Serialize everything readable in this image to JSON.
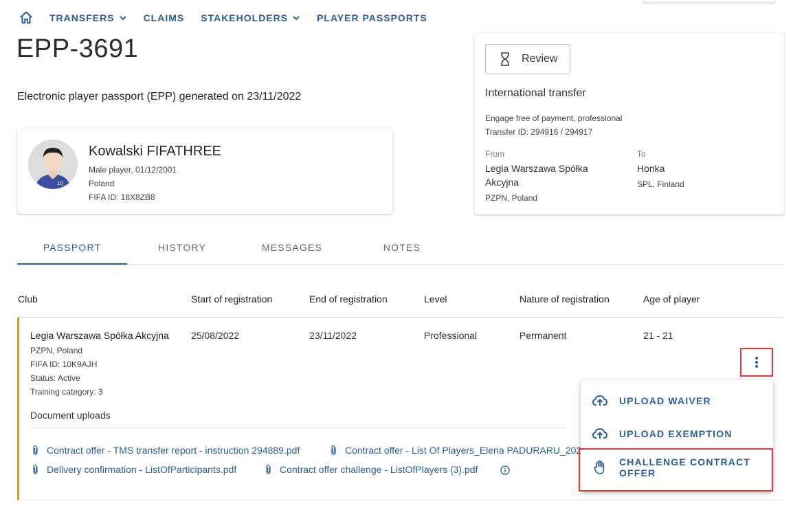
{
  "nav": {
    "items": [
      {
        "label": "TRANSFERS",
        "dropdown": true
      },
      {
        "label": "CLAIMS",
        "dropdown": false
      },
      {
        "label": "STAKEHOLDERS",
        "dropdown": true
      },
      {
        "label": "PLAYER PASSPORTS",
        "dropdown": false
      }
    ],
    "home_icon": "home-icon"
  },
  "page": {
    "title": "EPP-3691",
    "subtitle": "Electronic player passport (EPP) generated on 23/11/2022"
  },
  "player": {
    "name": "Kowalski FIFATHREE",
    "details": "Male player, 01/12/2001",
    "country": "Poland",
    "fifa_id": "FIFA ID: 18X8ZB8",
    "jersey_number": "10"
  },
  "transfer": {
    "review_label": "Review",
    "title": "International transfer",
    "type": "Engage free of payment, professional",
    "transfer_id": "Transfer ID: 294916 / 294917",
    "from_label": "From",
    "from_club_line1": "Legia Warszawa Spółka",
    "from_club_line2": "Akcyjna",
    "from_assoc": "PZPN, Poland",
    "to_label": "To",
    "to_club": "Honka",
    "to_assoc": "SPL, Finland"
  },
  "tabs": [
    {
      "label": "PASSPORT",
      "active": true
    },
    {
      "label": "HISTORY",
      "active": false
    },
    {
      "label": "MESSAGES",
      "active": false
    },
    {
      "label": "NOTES",
      "active": false
    }
  ],
  "table": {
    "headers": [
      "Club",
      "Start of registration",
      "End of registration",
      "Level",
      "Nature of registration",
      "Age of player"
    ],
    "row": {
      "club": "Legia Warszawa Spółka Akcyjna",
      "assoc": "PZPN, Poland",
      "fifa_id": "FIFA ID: 10K9AJH",
      "status": "Status: Active",
      "training": "Training category: 3",
      "start": "25/08/2022",
      "end": "23/11/2022",
      "level": "Professional",
      "nature": "Permanent",
      "age": "21 - 21"
    },
    "documents_title": "Document uploads",
    "documents": [
      "Contract offer - TMS transfer report - instruction 294889.pdf",
      "Contract offer - List Of Players_Elena PADURARU_202",
      "Delivery confirmation - ListOfParticipants.pdf",
      "Contract offer challenge - ListOfPlayers (3).pdf"
    ]
  },
  "menu": {
    "items": [
      {
        "label": "UPLOAD WAIVER",
        "icon": "cloud-upload-icon"
      },
      {
        "label": "UPLOAD EXEMPTION",
        "icon": "cloud-upload-icon"
      },
      {
        "label_line1": "CHALLENGE CONTRACT",
        "label_line2": "OFFER",
        "icon": "hand-icon"
      }
    ]
  },
  "colors": {
    "accent": "#2c5d95",
    "row_accent": "#d99a1e",
    "highlight": "#e53935"
  }
}
